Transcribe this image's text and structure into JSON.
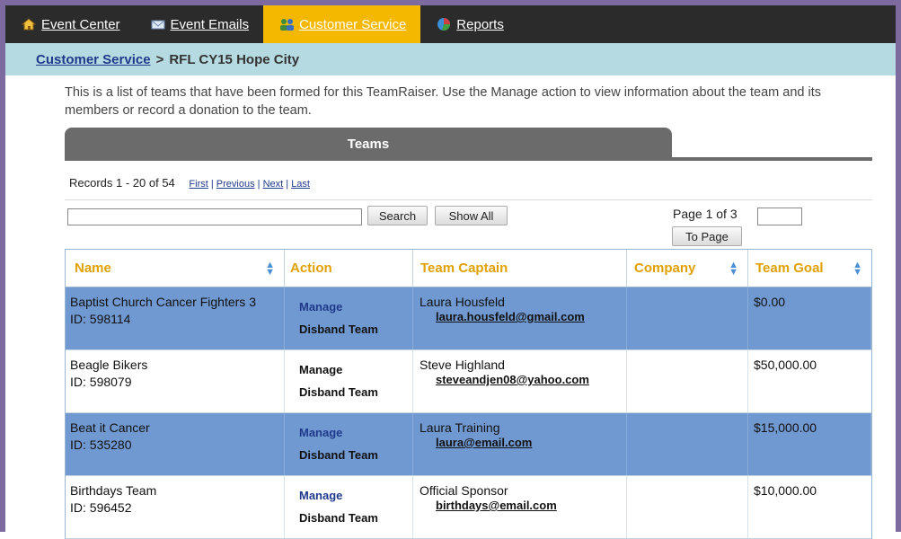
{
  "nav": {
    "tabs": [
      {
        "label": "Event Center",
        "icon": "home-icon"
      },
      {
        "label": "Event Emails",
        "icon": "envelope-icon"
      },
      {
        "label": "Customer Service",
        "icon": "people-icon",
        "active": true
      },
      {
        "label": "Reports",
        "icon": "pie-chart-icon"
      }
    ]
  },
  "breadcrumb": {
    "link": "Customer Service",
    "separator": ">",
    "current": "RFL CY15 Hope City"
  },
  "intro": "This is a list of teams that have been formed for this TeamRaiser. Use the Manage action to view information about the team and its members or record a donation to the team.",
  "section": {
    "title": "Teams"
  },
  "records": {
    "summary": "Records 1 - 20 of 54",
    "pager": [
      "First",
      "Previous",
      "Next",
      "Last"
    ]
  },
  "search": {
    "value": "",
    "button": "Search",
    "show_all": "Show All"
  },
  "paging": {
    "label": "Page 1 of 3",
    "value": "",
    "button": "To Page"
  },
  "table": {
    "headers": [
      "Name",
      "Action",
      "Team Captain",
      "Company",
      "Team Goal"
    ],
    "rows": [
      {
        "name": "Baptist Church Cancer Fighters 3",
        "id": "ID: 598114",
        "manage": "Manage",
        "disband": "Disband Team",
        "captain": "Laura Housfeld",
        "email": "laura.housfeld@gmail.com",
        "company": "",
        "goal": "$0.00"
      },
      {
        "name": "Beagle Bikers",
        "id": "ID: 598079",
        "manage": "Manage",
        "disband": "Disband Team",
        "captain": "Steve Highland",
        "email": "steveandjen08@yahoo.com",
        "company": "",
        "goal": "$50,000.00"
      },
      {
        "name": "Beat it Cancer",
        "id": "ID: 535280",
        "manage": "Manage",
        "disband": "Disband Team",
        "captain": "Laura Training",
        "email": "laura@email.com",
        "company": "",
        "goal": "$15,000.00"
      },
      {
        "name": "Birthdays Team",
        "id": "ID: 596452",
        "manage": "Manage",
        "disband": "Disband Team",
        "captain": "Official Sponsor",
        "email": "birthdays@email.com",
        "company": "",
        "goal": "$10,000.00"
      }
    ]
  },
  "colors": {
    "nav_bg": "#2b2b2b",
    "nav_active": "#f5b800",
    "crumb_bg": "#b6dae2",
    "row_highlight": "#7199d1",
    "header_text": "#e0a100",
    "frame": "#7d6a9e"
  }
}
